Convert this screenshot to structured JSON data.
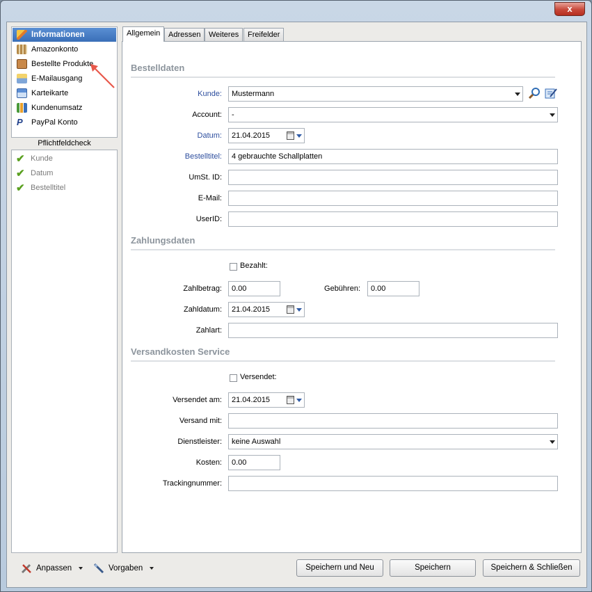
{
  "window": {
    "close_label": "x"
  },
  "nav": {
    "items": [
      {
        "label": "Informationen",
        "icon": "pencil-icon",
        "active": true
      },
      {
        "label": "Amazonkonto",
        "icon": "amazon-icon"
      },
      {
        "label": "Bestellte Produkte",
        "icon": "package-icon"
      },
      {
        "label": "E-Mailausgang",
        "icon": "mail-outbox-icon"
      },
      {
        "label": "Karteikarte",
        "icon": "card-icon"
      },
      {
        "label": "Kundenumsatz",
        "icon": "bar-chart-icon"
      },
      {
        "label": "PayPal Konto",
        "icon": "paypal-icon"
      }
    ]
  },
  "pflichtfeld": {
    "header": "Pflichtfeldcheck",
    "items": [
      "Kunde",
      "Datum",
      "Bestelltitel"
    ]
  },
  "tabs": [
    "Allgemein",
    "Adressen",
    "Weiteres",
    "Freifelder"
  ],
  "bestelldaten": {
    "title": "Bestelldaten",
    "kunde_label": "Kunde:",
    "kunde_value": "Mustermann",
    "account_label": "Account:",
    "account_value": "-",
    "datum_label": "Datum:",
    "datum_value": "21.04.2015",
    "titel_label": "Bestelltitel:",
    "titel_value": "4 gebrauchte Schallplatten",
    "ust_label": "UmSt. ID:",
    "ust_value": "",
    "email_label": "E-Mail:",
    "email_value": "",
    "userid_label": "UserID:",
    "userid_value": ""
  },
  "zahlungsdaten": {
    "title": "Zahlungsdaten",
    "bezahlt_label": "Bezahlt:",
    "zahlbetrag_label": "Zahlbetrag:",
    "zahlbetrag_value": "0.00",
    "gebuehren_label": "Gebühren:",
    "gebuehren_value": "0.00",
    "zahldatum_label": "Zahldatum:",
    "zahldatum_value": "21.04.2015",
    "zahlart_label": "Zahlart:",
    "zahlart_value": ""
  },
  "versand": {
    "title": "Versandkosten Service",
    "versendet_label": "Versendet:",
    "versendet_am_label": "Versendet am:",
    "versendet_am_value": "21.04.2015",
    "versand_mit_label": "Versand mit:",
    "versand_mit_value": "",
    "dienstleister_label": "Dienstleister:",
    "dienstleister_value": "keine Auswahl",
    "kosten_label": "Kosten:",
    "kosten_value": "0.00",
    "tracking_label": "Trackingnummer:",
    "tracking_value": ""
  },
  "bottom": {
    "anpassen": "Anpassen",
    "vorgaben": "Vorgaben",
    "save_new": "Speichern und Neu",
    "save": "Speichern",
    "save_close": "Speichern & Schließen"
  },
  "colors": {
    "accent": "#3a6fb8",
    "required_label": "#2d4e9e",
    "annotation_arrow": "#e8584a"
  }
}
